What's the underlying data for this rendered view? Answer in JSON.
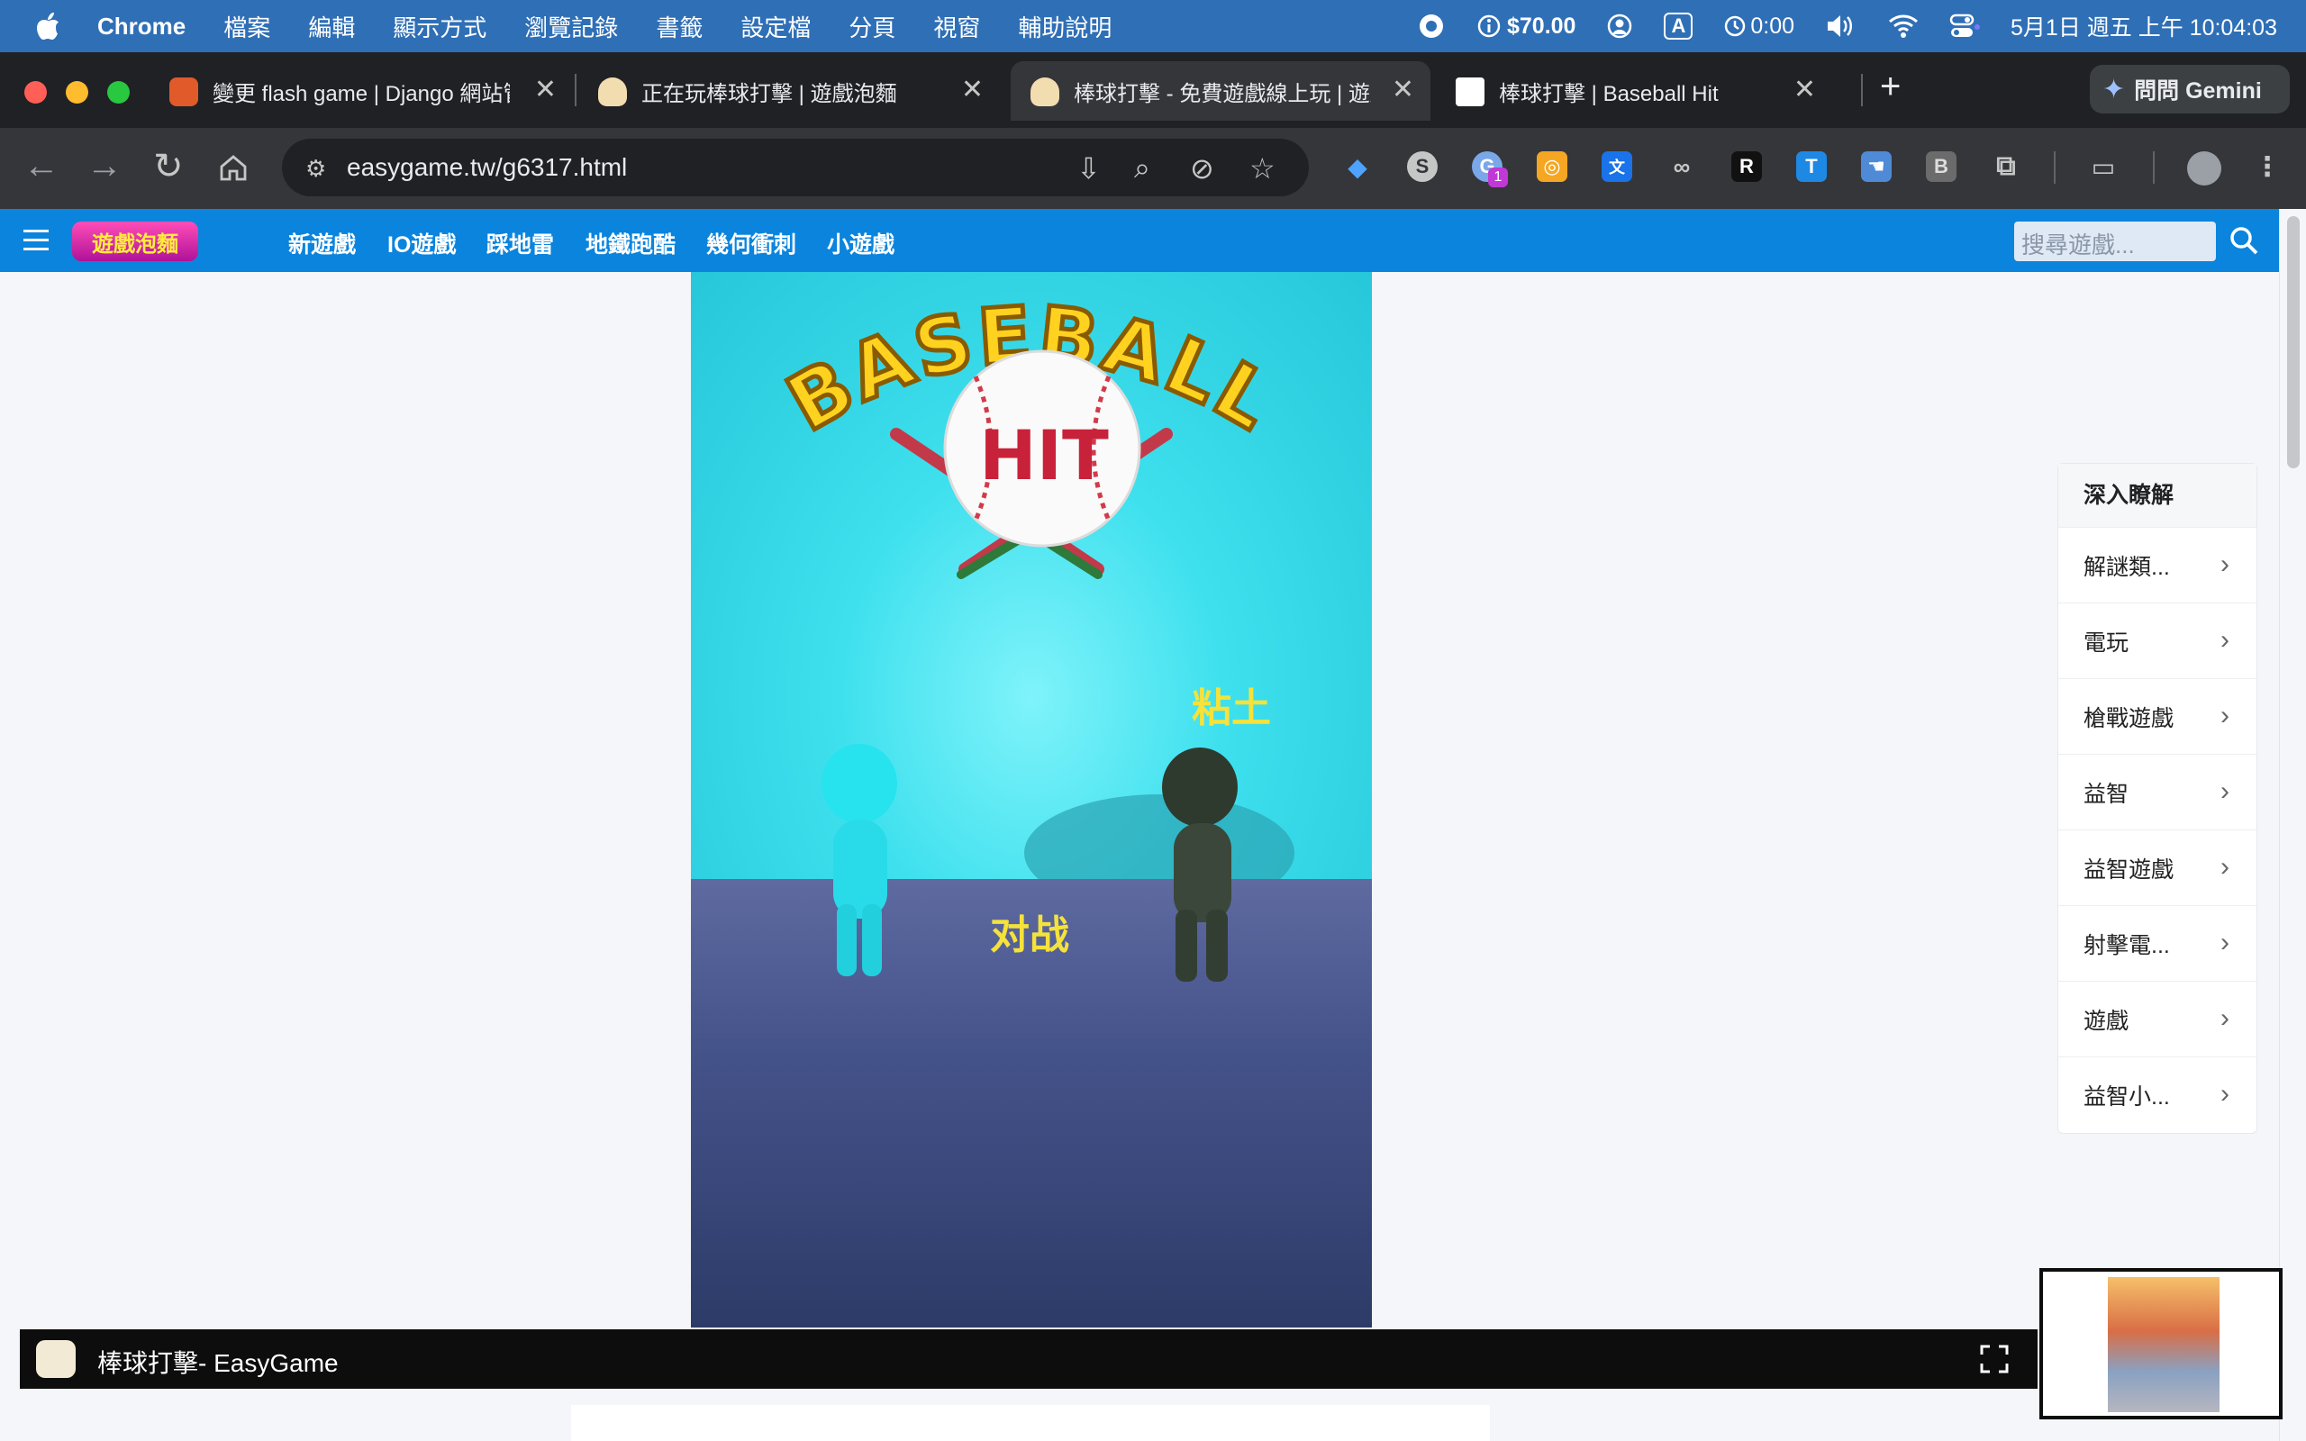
{
  "menubar": {
    "app": "Chrome",
    "items": [
      "檔案",
      "編輯",
      "顯示方式",
      "瀏覽記錄",
      "書籤",
      "設定檔",
      "分頁",
      "視窗",
      "輔助說明"
    ],
    "money": "$70.00",
    "timer": "0:00",
    "input_badge": "A",
    "datetime": "5月1日 週五 上午 10:04:03"
  },
  "tabs": [
    {
      "title": "變更 flash game | Django 網站管理",
      "favicon": "mario-icon"
    },
    {
      "title": "正在玩棒球打擊 | 遊戲泡麵",
      "favicon": "noodle-icon"
    },
    {
      "title": "棒球打擊 - 免費遊戲線上玩 | 遊戲泡麵",
      "favicon": "noodle-icon"
    },
    {
      "title": "棒球打擊 | Baseball Hit",
      "favicon": "unity-icon"
    }
  ],
  "gemini_label": "問問 Gemini",
  "address": {
    "url": "easygame.tw/g6317.html"
  },
  "extensions_badge": "1",
  "ext_letters": {
    "r": "R",
    "t": "T",
    "b": "B"
  },
  "site": {
    "logo_text": "遊戲泡麵",
    "nav": [
      "新遊戲",
      "IO遊戲",
      "踩地雷",
      "地鐵跑酷",
      "幾何衝刺",
      "小遊戲"
    ],
    "search_placeholder": "搜尋遊戲..."
  },
  "game": {
    "logo_top": "BASEBALL",
    "logo_hit": "HIT",
    "opponent_label": "粘土",
    "vs_label": "对战"
  },
  "sidebar_card": {
    "heading": "深入瞭解",
    "items": [
      "解謎類...",
      "電玩",
      "槍戰遊戲",
      "益智",
      "益智遊戲",
      "射擊電...",
      "遊戲",
      "益智小..."
    ]
  },
  "bottombar": {
    "title": "棒球打擊- EasyGame"
  }
}
